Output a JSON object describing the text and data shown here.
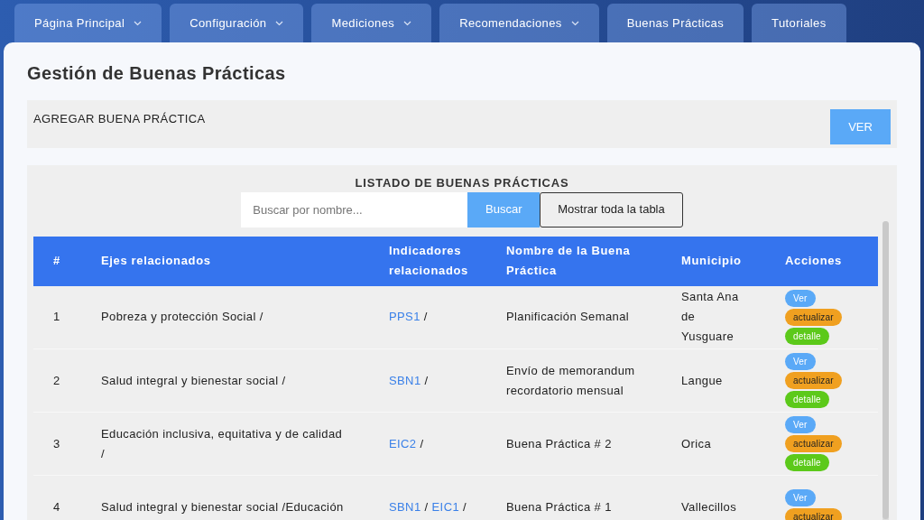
{
  "nav": [
    {
      "label": "Página Principal",
      "has_menu": true
    },
    {
      "label": "Configuración",
      "has_menu": true
    },
    {
      "label": "Mediciones",
      "has_menu": true
    },
    {
      "label": "Recomendaciones",
      "has_menu": true
    },
    {
      "label": "Buenas Prácticas",
      "has_menu": false
    },
    {
      "label": "Tutoriales",
      "has_menu": false
    }
  ],
  "page_title": "Gestión de Buenas Prácticas",
  "add_section": {
    "label": "AGREGAR BUENA PRÁCTICA",
    "button": "VER"
  },
  "list_section": {
    "title": "LISTADO DE BUENAS PRÁCTICAS",
    "search": {
      "placeholder": "Buscar por nombre..."
    },
    "search_button": "Buscar",
    "show_all_button": "Mostrar toda la tabla"
  },
  "table": {
    "columns": [
      "#",
      "Ejes relacionados",
      "Indicadores relacionados",
      "Nombre de la Buena Práctica",
      "Municipio",
      "Acciones"
    ],
    "rows": [
      {
        "num": "1",
        "ejes": "Pobreza y protección Social /",
        "indicadores": [
          {
            "code": "PPS1",
            "sep": "/"
          }
        ],
        "nombre": "Planificación Semanal",
        "municipio": "Santa Ana de Yusguare",
        "actions": [
          {
            "label": "Ver",
            "kind": "view"
          },
          {
            "label": "actualizar",
            "kind": "update"
          },
          {
            "label": "detalle",
            "kind": "detail"
          }
        ]
      },
      {
        "num": "2",
        "ejes": "Salud integral y bienestar social /",
        "indicadores": [
          {
            "code": "SBN1",
            "sep": "/"
          }
        ],
        "nombre": "Envío de memorandum recordatorio mensual",
        "municipio": "Langue",
        "actions": [
          {
            "label": "Ver",
            "kind": "view"
          },
          {
            "label": "actualizar",
            "kind": "update"
          },
          {
            "label": "detalle",
            "kind": "detail"
          }
        ]
      },
      {
        "num": "3",
        "ejes": "Educación inclusiva, equitativa y de calidad /",
        "indicadores": [
          {
            "code": "EIC2",
            "sep": "/"
          }
        ],
        "nombre": "Buena Práctica # 2",
        "municipio": "Orica",
        "actions": [
          {
            "label": "Ver",
            "kind": "view"
          },
          {
            "label": "actualizar",
            "kind": "update"
          },
          {
            "label": "detalle",
            "kind": "detail"
          }
        ]
      },
      {
        "num": "4",
        "ejes": "Salud integral y bienestar social /Educación",
        "indicadores": [
          {
            "code": "SBN1",
            "sep": "/"
          },
          {
            "code": "EIC1",
            "sep": "/"
          }
        ],
        "nombre": "Buena Práctica # 1",
        "municipio": "Vallecillos",
        "actions": [
          {
            "label": "Ver",
            "kind": "view"
          },
          {
            "label": "actualizar",
            "kind": "update"
          }
        ]
      }
    ]
  }
}
